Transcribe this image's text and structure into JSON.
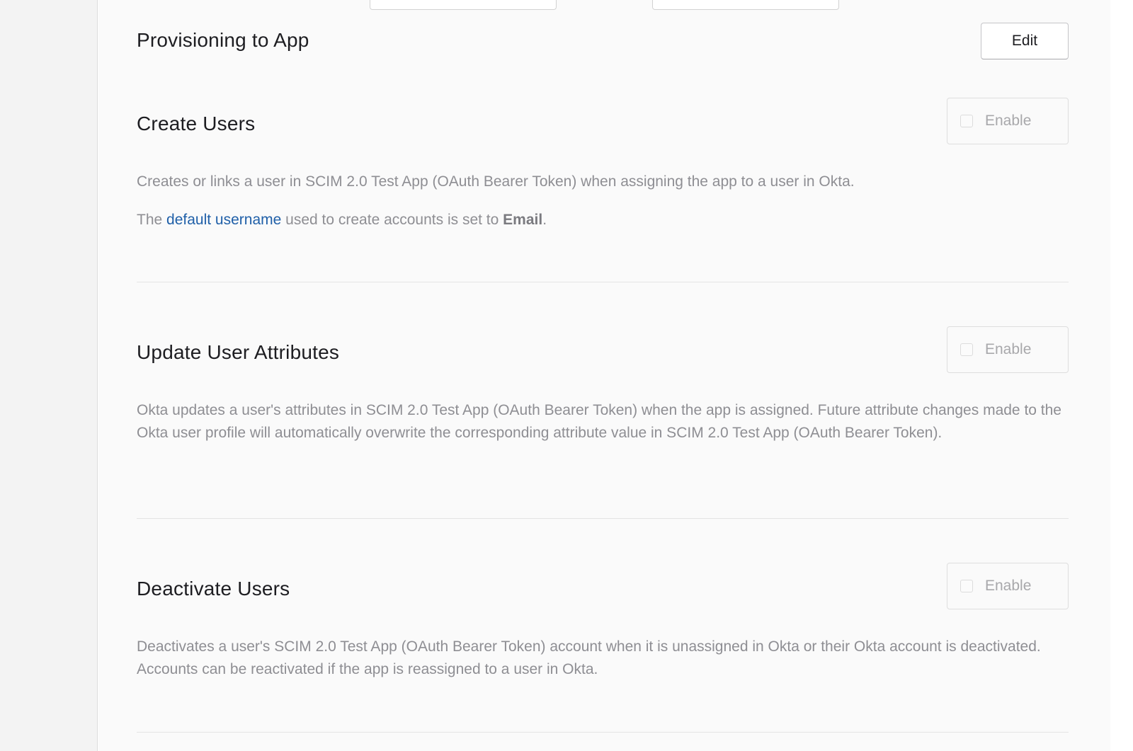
{
  "provisioning": {
    "title": "Provisioning to App",
    "edit_label": "Edit"
  },
  "sections": {
    "create_users": {
      "title": "Create Users",
      "enable_label": "Enable",
      "description": "Creates or links a user in SCIM 2.0 Test App (OAuth Bearer Token) when assigning the app to a user in Okta.",
      "username_prefix": "The",
      "username_link": "default username",
      "username_middle": "used to create accounts is set to",
      "username_value": "Email",
      "username_suffix": "."
    },
    "update_attributes": {
      "title": "Update User Attributes",
      "enable_label": "Enable",
      "description": "Okta updates a user's attributes in SCIM 2.0 Test App (OAuth Bearer Token) when the app is assigned. Future attribute changes made to the Okta user profile will automatically overwrite the corresponding attribute value in SCIM 2.0 Test App (OAuth Bearer Token)."
    },
    "deactivate_users": {
      "title": "Deactivate Users",
      "enable_label": "Enable",
      "description": "Deactivates a user's SCIM 2.0 Test App (OAuth Bearer Token) account when it is unassigned in Okta or their Okta account is deactivated. Accounts can be reactivated if the app is reassigned to a user in Okta."
    }
  },
  "colors": {
    "link": "#1f5fa8",
    "heading": "#1d1d21",
    "body_text": "#8e8e93",
    "panel_bg": "#fafafa",
    "sidebar_bg": "#f3f3f3"
  }
}
